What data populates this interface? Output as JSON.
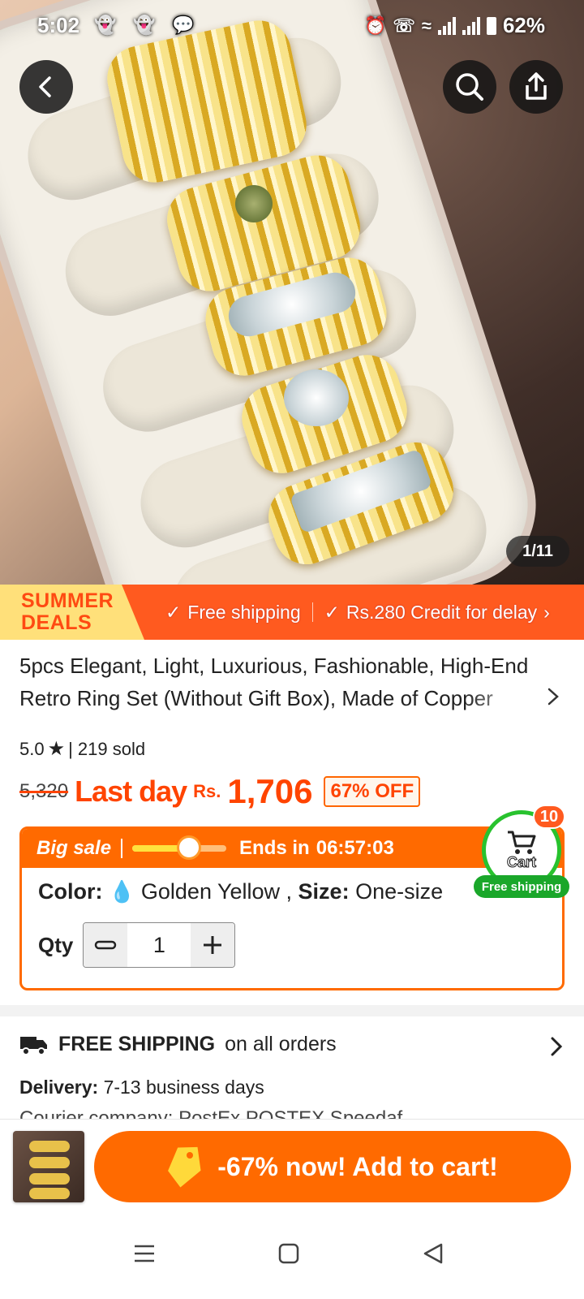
{
  "status_bar": {
    "time": "5:02",
    "battery": "62%"
  },
  "gallery": {
    "counter": "1/11"
  },
  "promo": {
    "deals_line1": "SUMMER",
    "deals_line2": "DEALS",
    "free_shipping": "Free shipping",
    "credit": "Rs.280 Credit for delay"
  },
  "product": {
    "title_line1": "5pcs Elegant, Light, Luxurious, Fashionable, High-End",
    "title_line2": "Retro Ring Set (Without Gift Box), Made of Copper",
    "rating": "5.0",
    "sold": "| 219 sold",
    "old_price": "5,320",
    "price_label": "Last day",
    "currency": "Rs.",
    "price": "1,706",
    "discount": "67% OFF"
  },
  "sale": {
    "label": "Big sale",
    "progress": 0.6,
    "ends_label": "Ends in",
    "countdown": "06:57:03",
    "color_label": "Color:",
    "color_value": "Golden Yellow ,",
    "size_label": "Size:",
    "size_value": "One-size",
    "qty_label": "Qty",
    "qty_value": "1"
  },
  "cart": {
    "label": "Cart",
    "count": "10",
    "badge": "Free shipping"
  },
  "shipping": {
    "title": "FREE SHIPPING",
    "subtitle": "on all orders",
    "delivery_label": "Delivery:",
    "delivery_value": "7-13 business days",
    "courier_text": "Courier company: PostEx  POSTEX  Speedaf"
  },
  "bottom": {
    "add_label": "-67% now! Add to cart!"
  },
  "colors": {
    "accent": "#ff6a00",
    "promo": "#ff5a1f",
    "green": "#28c22e"
  }
}
